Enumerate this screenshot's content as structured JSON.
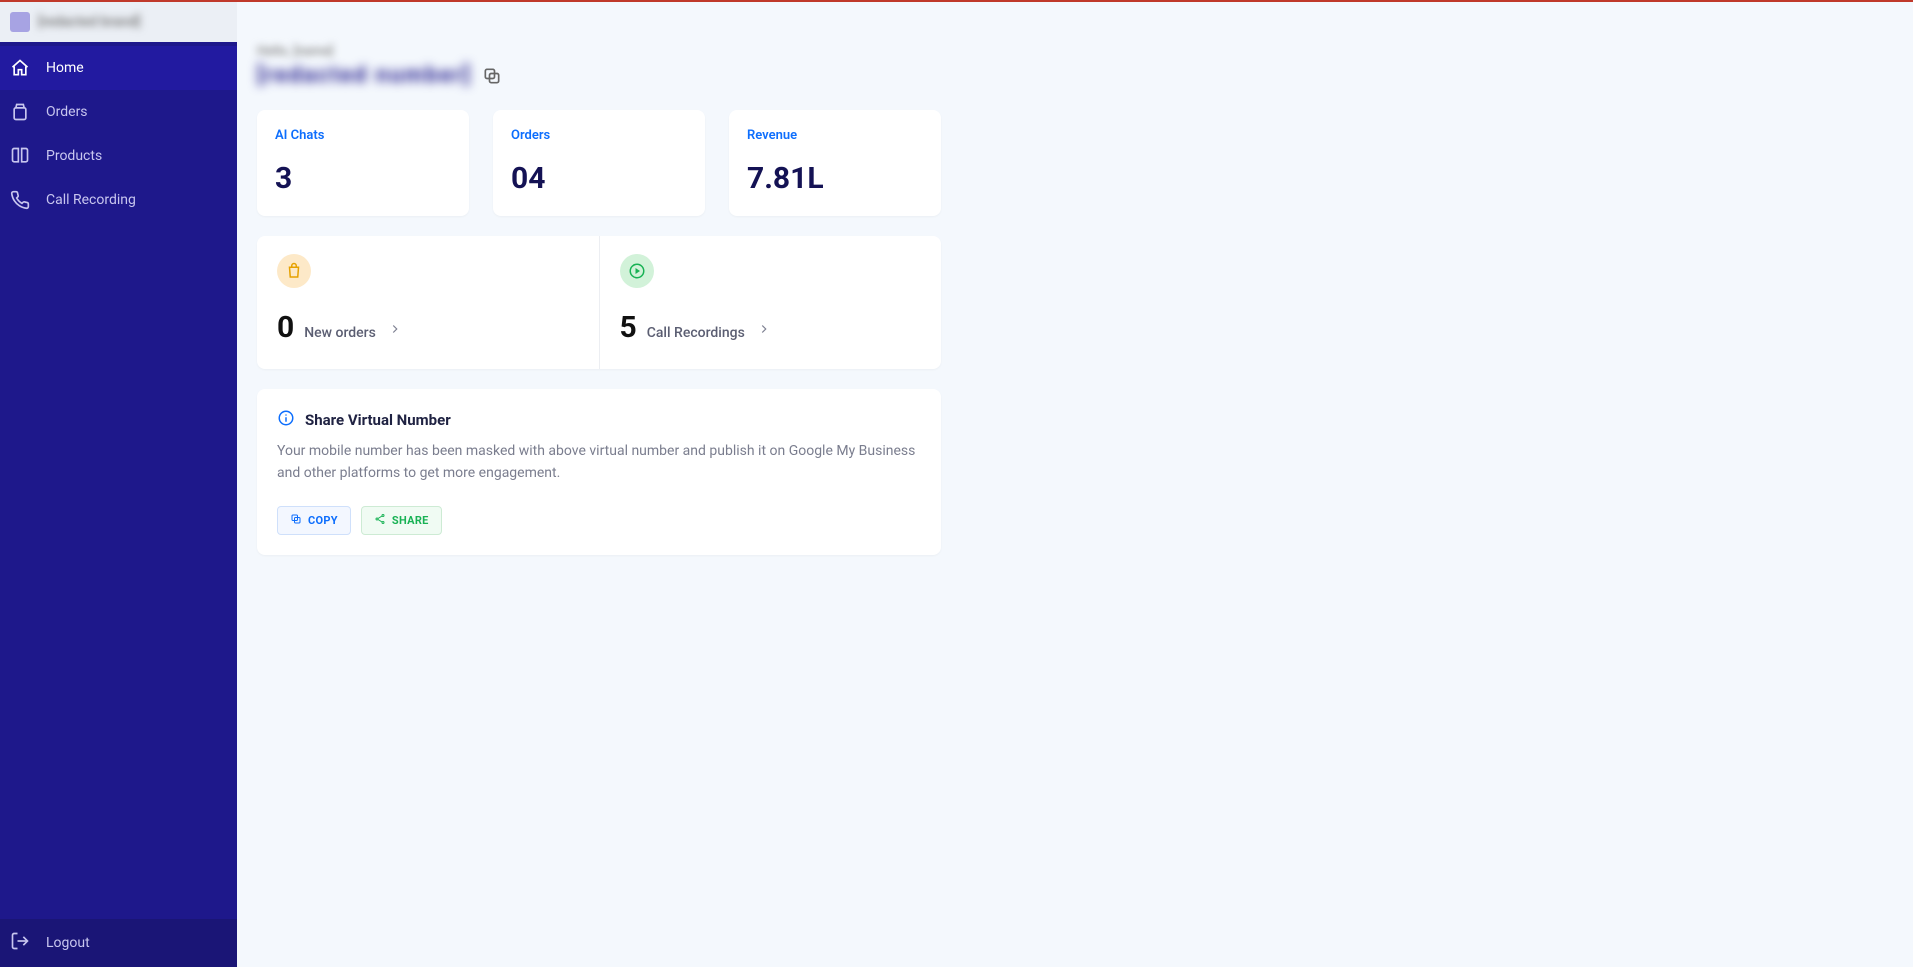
{
  "brand": {
    "name": "[redacted brand]"
  },
  "sidebar": {
    "items": [
      {
        "label": "Home"
      },
      {
        "label": "Orders"
      },
      {
        "label": "Products"
      },
      {
        "label": "Call Recording"
      }
    ],
    "logout_label": "Logout"
  },
  "header": {
    "hello_line": "Hello, [name]",
    "phone_number": "[redacted number]"
  },
  "stats": {
    "ai_chats": {
      "label": "AI Chats",
      "value": "3"
    },
    "orders": {
      "label": "Orders",
      "value": "04"
    },
    "revenue": {
      "label": "Revenue",
      "value": "7.81L"
    }
  },
  "actions": {
    "new_orders": {
      "count": "0",
      "label": "New orders"
    },
    "call_recordings": {
      "count": "5",
      "label": "Call Recordings"
    }
  },
  "share": {
    "title": "Share Virtual Number",
    "body": "Your mobile number has been masked with above virtual number and publish it on Google My Business and other platforms to get more engagement.",
    "copy_label": "COPY",
    "share_label": "SHARE"
  }
}
